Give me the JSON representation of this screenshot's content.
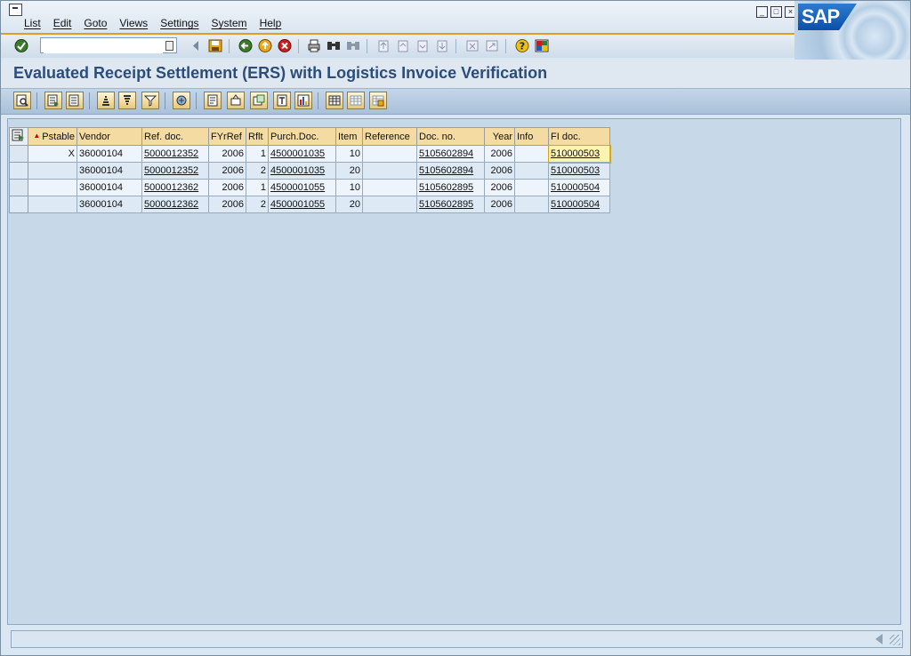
{
  "menu": {
    "items": [
      "List",
      "Edit",
      "Goto",
      "Views",
      "Settings",
      "System",
      "Help"
    ]
  },
  "logo": {
    "text": "SAP"
  },
  "command_field": {
    "value": ""
  },
  "title": "Evaluated Receipt Settlement (ERS) with Logistics Invoice Verification",
  "grid": {
    "columns": [
      "Pstable",
      "Vendor",
      "Ref. doc.",
      "FYrRef",
      "Rflt",
      "Purch.Doc.",
      "Item",
      "Reference",
      "Doc. no.",
      "Year",
      "Info",
      "FI doc."
    ],
    "rows": [
      [
        "X",
        "36000104",
        "5000012352",
        "2006",
        "1",
        "4500001035",
        "10",
        "",
        "5105602894",
        "2006",
        "",
        "510000503"
      ],
      [
        "",
        "36000104",
        "5000012352",
        "2006",
        "2",
        "4500001035",
        "20",
        "",
        "5105602894",
        "2006",
        "",
        "510000503"
      ],
      [
        "",
        "36000104",
        "5000012362",
        "2006",
        "1",
        "4500001055",
        "10",
        "",
        "5105602895",
        "2006",
        "",
        "510000504"
      ],
      [
        "",
        "36000104",
        "5000012362",
        "2006",
        "2",
        "4500001055",
        "20",
        "",
        "5105602895",
        "2006",
        "",
        "510000504"
      ]
    ]
  },
  "colors": {
    "accent": "#e39a28",
    "title": "#2a4d7c",
    "header": "#f4dba1"
  }
}
